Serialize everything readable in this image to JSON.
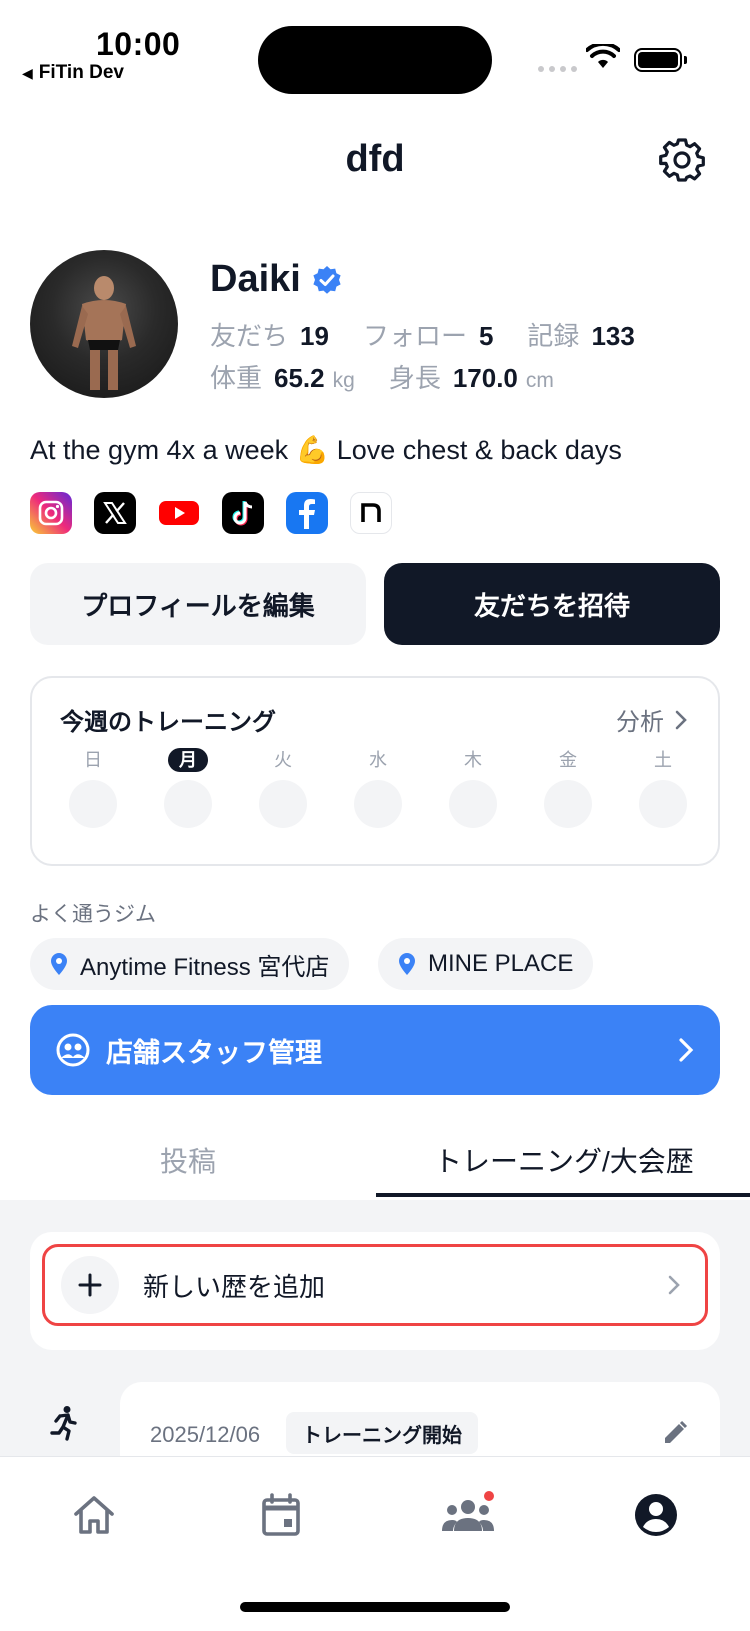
{
  "status_bar": {
    "time": "10:00",
    "back_app": "FiTin Dev",
    "back_icon": "back-triangle-icon"
  },
  "header": {
    "title": "dfd",
    "settings_icon": "gear-icon"
  },
  "profile": {
    "name": "Daiki",
    "verified_icon": "verified-badge-icon",
    "stats": {
      "friends_label": "友だち",
      "friends_value": "19",
      "follow_label": "フォロー",
      "follow_value": "5",
      "records_label": "記録",
      "records_value": "133"
    },
    "body": {
      "weight_label": "体重",
      "weight_value": "65.2",
      "weight_unit": "kg",
      "height_label": "身長",
      "height_value": "170.0",
      "height_unit": "cm"
    },
    "bio": "At the gym 4x a week 💪 Love chest & back days",
    "socials": [
      "instagram-icon",
      "x-icon",
      "youtube-icon",
      "tiktok-icon",
      "facebook-icon",
      "note-icon"
    ]
  },
  "actions": {
    "edit_profile": "プロフィールを編集",
    "invite_friends": "友だちを招待"
  },
  "weekly": {
    "title": "今週のトレーニング",
    "analysis": "分析",
    "days": [
      {
        "label": "日",
        "active": false
      },
      {
        "label": "月",
        "active": true
      },
      {
        "label": "火",
        "active": false
      },
      {
        "label": "水",
        "active": false
      },
      {
        "label": "木",
        "active": false
      },
      {
        "label": "金",
        "active": false
      },
      {
        "label": "土",
        "active": false
      }
    ]
  },
  "gyms": {
    "label": "よく通うジム",
    "items": [
      "Anytime Fitness 宮代店",
      "MINE PLACE"
    ]
  },
  "staff": {
    "label": "店舗スタッフ管理"
  },
  "tabs": {
    "posts": "投稿",
    "history": "トレーニング/大会歴",
    "active": "history"
  },
  "history": {
    "add_label": "新しい歴を追加",
    "entries": [
      {
        "date": "2025/12/06",
        "tag": "トレーニング開始"
      }
    ]
  },
  "bottom_nav": {
    "items": [
      "home-icon",
      "calendar-icon",
      "friends-icon",
      "profile-icon"
    ],
    "active": "profile-icon"
  },
  "colors": {
    "primary_dark": "#111827",
    "accent_blue": "#3b82f6",
    "highlight_red": "#ef4444",
    "muted": "#9ca3af",
    "chip_bg": "#f3f4f6"
  }
}
